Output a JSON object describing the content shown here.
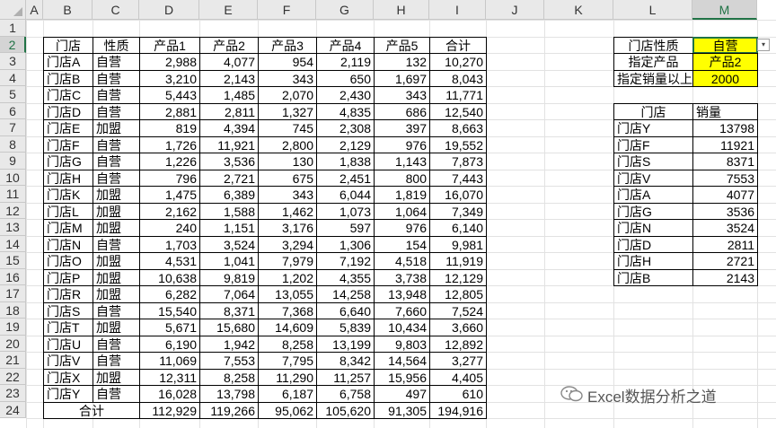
{
  "columns": [
    "A",
    "B",
    "C",
    "D",
    "E",
    "F",
    "G",
    "H",
    "I",
    "J",
    "K",
    "L",
    "M"
  ],
  "rows": [
    "1",
    "2",
    "3",
    "4",
    "5",
    "6",
    "7",
    "8",
    "9",
    "10",
    "11",
    "12",
    "13",
    "14",
    "15",
    "16",
    "17",
    "18",
    "19",
    "20",
    "21",
    "22",
    "23",
    "24"
  ],
  "main_table": {
    "headers": [
      "门店",
      "性质",
      "产品1",
      "产品2",
      "产品3",
      "产品4",
      "产品5",
      "合计"
    ],
    "rows": [
      [
        "门店A",
        "自营",
        "2,988",
        "4,077",
        "954",
        "2,119",
        "132",
        "10,270"
      ],
      [
        "门店B",
        "自营",
        "3,210",
        "2,143",
        "343",
        "650",
        "1,697",
        "8,043"
      ],
      [
        "门店C",
        "自营",
        "5,443",
        "1,485",
        "2,070",
        "2,430",
        "343",
        "11,771"
      ],
      [
        "门店D",
        "自营",
        "2,881",
        "2,811",
        "1,327",
        "4,835",
        "686",
        "12,540"
      ],
      [
        "门店E",
        "加盟",
        "819",
        "4,394",
        "745",
        "2,308",
        "397",
        "8,663"
      ],
      [
        "门店F",
        "自营",
        "1,726",
        "11,921",
        "2,800",
        "2,129",
        "976",
        "19,552"
      ],
      [
        "门店G",
        "自营",
        "1,226",
        "3,536",
        "130",
        "1,838",
        "1,143",
        "7,873"
      ],
      [
        "门店H",
        "自营",
        "796",
        "2,721",
        "675",
        "2,451",
        "800",
        "7,443"
      ],
      [
        "门店K",
        "加盟",
        "1,475",
        "6,389",
        "343",
        "6,044",
        "1,819",
        "16,070"
      ],
      [
        "门店L",
        "加盟",
        "2,162",
        "1,588",
        "1,462",
        "1,073",
        "1,064",
        "7,349"
      ],
      [
        "门店M",
        "加盟",
        "240",
        "1,151",
        "3,176",
        "597",
        "976",
        "6,140"
      ],
      [
        "门店N",
        "自营",
        "1,703",
        "3,524",
        "3,294",
        "1,306",
        "154",
        "9,981"
      ],
      [
        "门店O",
        "加盟",
        "4,531",
        "1,041",
        "7,979",
        "7,192",
        "4,518",
        "11,919"
      ],
      [
        "门店P",
        "加盟",
        "10,638",
        "9,819",
        "1,202",
        "4,355",
        "3,738",
        "12,129"
      ],
      [
        "门店R",
        "加盟",
        "6,282",
        "7,064",
        "13,055",
        "14,258",
        "13,948",
        "12,805"
      ],
      [
        "门店S",
        "自营",
        "15,540",
        "8,371",
        "7,368",
        "6,640",
        "7,660",
        "7,524"
      ],
      [
        "门店T",
        "加盟",
        "5,671",
        "15,680",
        "14,609",
        "5,839",
        "10,434",
        "3,660"
      ],
      [
        "门店U",
        "自营",
        "6,190",
        "1,942",
        "8,258",
        "13,199",
        "9,803",
        "12,892"
      ],
      [
        "门店V",
        "自营",
        "11,069",
        "7,553",
        "7,795",
        "8,342",
        "14,564",
        "3,277"
      ],
      [
        "门店X",
        "加盟",
        "12,311",
        "8,258",
        "11,290",
        "11,257",
        "15,956",
        "4,405"
      ],
      [
        "门店Y",
        "自营",
        "16,028",
        "13,798",
        "6,187",
        "6,758",
        "497",
        "610"
      ]
    ],
    "total_label": "合计",
    "totals": [
      "112,929",
      "119,266",
      "95,062",
      "105,620",
      "91,305",
      "194,916"
    ]
  },
  "criteria": {
    "store_type_label": "门店性质",
    "store_type_value": "自营",
    "product_label": "指定产品",
    "product_value": "产品2",
    "min_sales_label": "指定销量以上",
    "min_sales_value": "2000"
  },
  "result_table": {
    "headers": [
      "门店",
      "销量"
    ],
    "rows": [
      [
        "门店Y",
        "13798"
      ],
      [
        "门店F",
        "11921"
      ],
      [
        "门店S",
        "8371"
      ],
      [
        "门店V",
        "7553"
      ],
      [
        "门店A",
        "4077"
      ],
      [
        "门店G",
        "3536"
      ],
      [
        "门店N",
        "3524"
      ],
      [
        "门店D",
        "2811"
      ],
      [
        "门店H",
        "2721"
      ],
      [
        "门店B",
        "2143"
      ]
    ]
  },
  "dropdown_arrow": "▾",
  "watermark": "Excel数据分析之道",
  "colors": {
    "highlight": "#ffff00",
    "selection": "#217346"
  }
}
